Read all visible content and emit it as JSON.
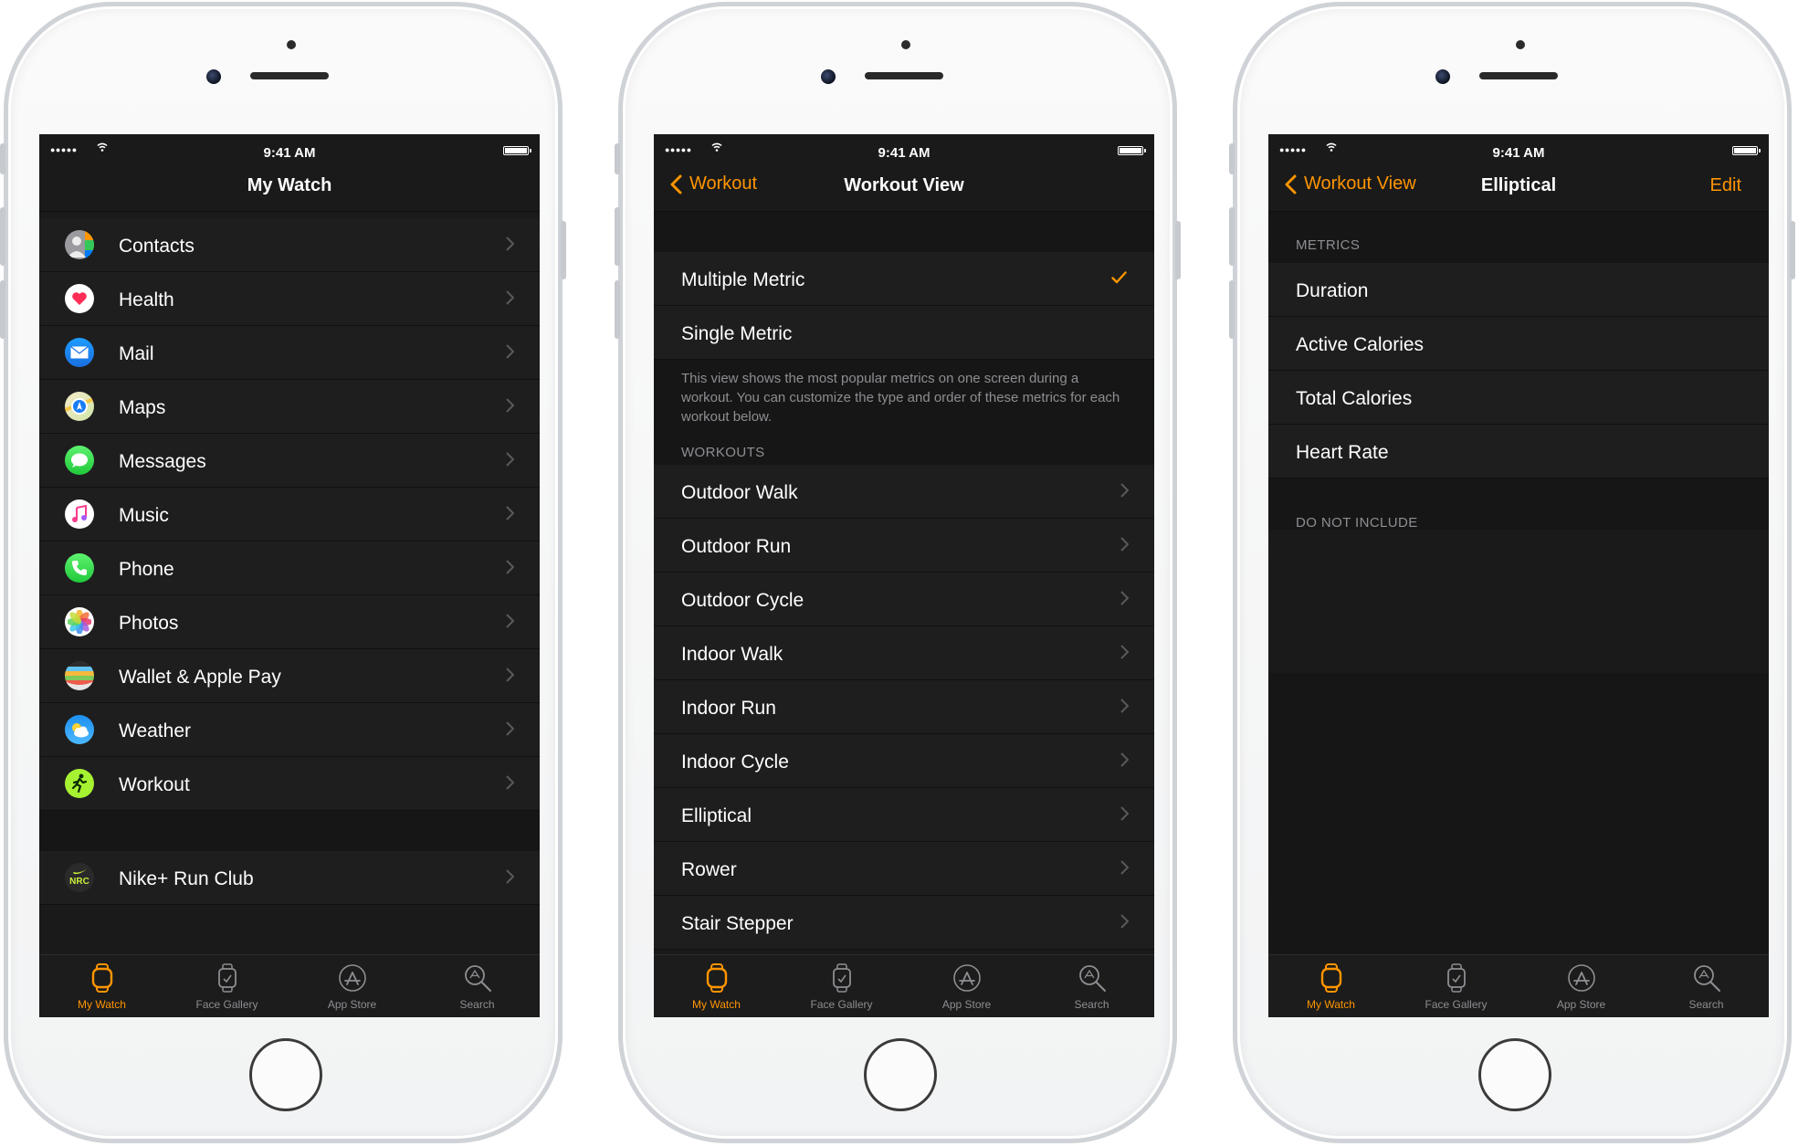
{
  "status_bar": {
    "signal": "●●●●●",
    "time": "9:41 AM"
  },
  "tab_bar": [
    "My Watch",
    "Face Gallery",
    "App Store",
    "Search"
  ],
  "colors": {
    "accent": "#ff9500",
    "background": "#1a1a1a",
    "secondary_text": "#8e8e93"
  },
  "screen1": {
    "title": "My Watch",
    "apps": [
      {
        "label": "Contacts",
        "icon": "contacts-icon"
      },
      {
        "label": "Health",
        "icon": "health-icon"
      },
      {
        "label": "Mail",
        "icon": "mail-icon"
      },
      {
        "label": "Maps",
        "icon": "maps-icon"
      },
      {
        "label": "Messages",
        "icon": "messages-icon"
      },
      {
        "label": "Music",
        "icon": "music-icon"
      },
      {
        "label": "Phone",
        "icon": "phone-icon"
      },
      {
        "label": "Photos",
        "icon": "photos-icon"
      },
      {
        "label": "Wallet & Apple Pay",
        "icon": "wallet-icon"
      },
      {
        "label": "Weather",
        "icon": "weather-icon"
      },
      {
        "label": "Workout",
        "icon": "workout-icon"
      }
    ],
    "third_party": [
      {
        "label": "Nike+ Run Club",
        "icon": "nike-run-club-icon",
        "badge": "NRC"
      }
    ]
  },
  "screen2": {
    "back_label": "Workout",
    "title": "Workout View",
    "options": [
      {
        "label": "Multiple Metric",
        "selected": true
      },
      {
        "label": "Single Metric",
        "selected": false
      }
    ],
    "footnote": "This view shows the most popular metrics on one screen during a workout. You can customize the type and order of these metrics for each workout below.",
    "workouts_header": "WORKOUTS",
    "workouts": [
      "Outdoor Walk",
      "Outdoor Run",
      "Outdoor Cycle",
      "Indoor Walk",
      "Indoor Run",
      "Indoor Cycle",
      "Elliptical",
      "Rower",
      "Stair Stepper"
    ]
  },
  "screen3": {
    "back_label": "Workout View",
    "title": "Elliptical",
    "edit_label": "Edit",
    "metrics_header": "METRICS",
    "metrics": [
      "Duration",
      "Active Calories",
      "Total Calories",
      "Heart Rate"
    ],
    "excluded_header": "DO NOT INCLUDE"
  }
}
